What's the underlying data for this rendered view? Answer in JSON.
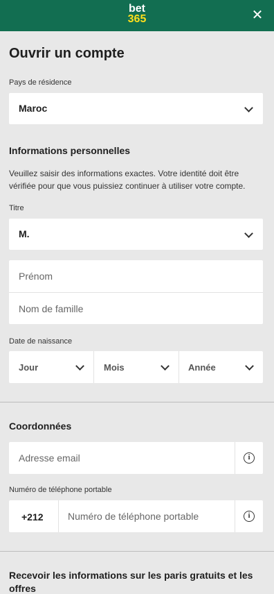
{
  "header": {
    "logo_line1": "bet",
    "logo_line2": "365",
    "close_glyph": "✕",
    "colors": {
      "bar": "#126e51",
      "logo_accent": "#ffdf1b"
    }
  },
  "title": "Ouvrir un compte",
  "residence": {
    "label": "Pays de résidence",
    "value": "Maroc"
  },
  "personal": {
    "heading": "Informations personnelles",
    "description": "Veuillez saisir des informations exactes. Votre identité doit être vérifiée pour que vous puissiez continuer à utiliser votre compte.",
    "title_label": "Titre",
    "title_value": "M.",
    "first_name_placeholder": "Prénom",
    "last_name_placeholder": "Nom de famille",
    "dob_label": "Date de naissance",
    "dob_day": "Jour",
    "dob_month": "Mois",
    "dob_year": "Année"
  },
  "contact": {
    "heading": "Coordonnées",
    "email_placeholder": "Adresse email",
    "phone_label": "Numéro de téléphone portable",
    "phone_prefix": "+212",
    "phone_placeholder": "Numéro de téléphone portable",
    "info_glyph": "i"
  },
  "offers": {
    "heading": "Recevoir les informations sur les paris gratuits et les offres"
  }
}
